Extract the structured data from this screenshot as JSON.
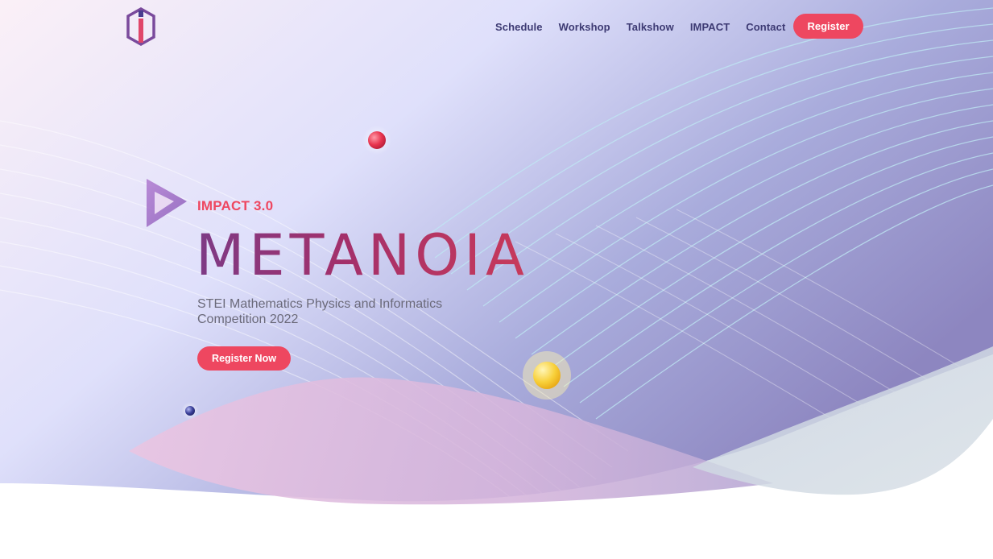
{
  "nav": {
    "logo_icon": "impact-logo-icon",
    "links": [
      {
        "label": "Schedule"
      },
      {
        "label": "Workshop"
      },
      {
        "label": "Talkshow"
      },
      {
        "label": "IMPACT"
      },
      {
        "label": "Contact"
      }
    ],
    "register_label": "Register"
  },
  "hero": {
    "play_icon": "play-triangle-icon",
    "subtitle": "IMPACT 3.0",
    "title": "METANOIA",
    "description": "STEI Mathematics Physics and Informatics Competition 2022",
    "cta_label": "Register Now"
  },
  "colors": {
    "accent": "#ee4760",
    "nav_text": "#3d3a73",
    "title_gradient_start": "#7d3a86",
    "title_gradient_end": "#c83a5a"
  }
}
